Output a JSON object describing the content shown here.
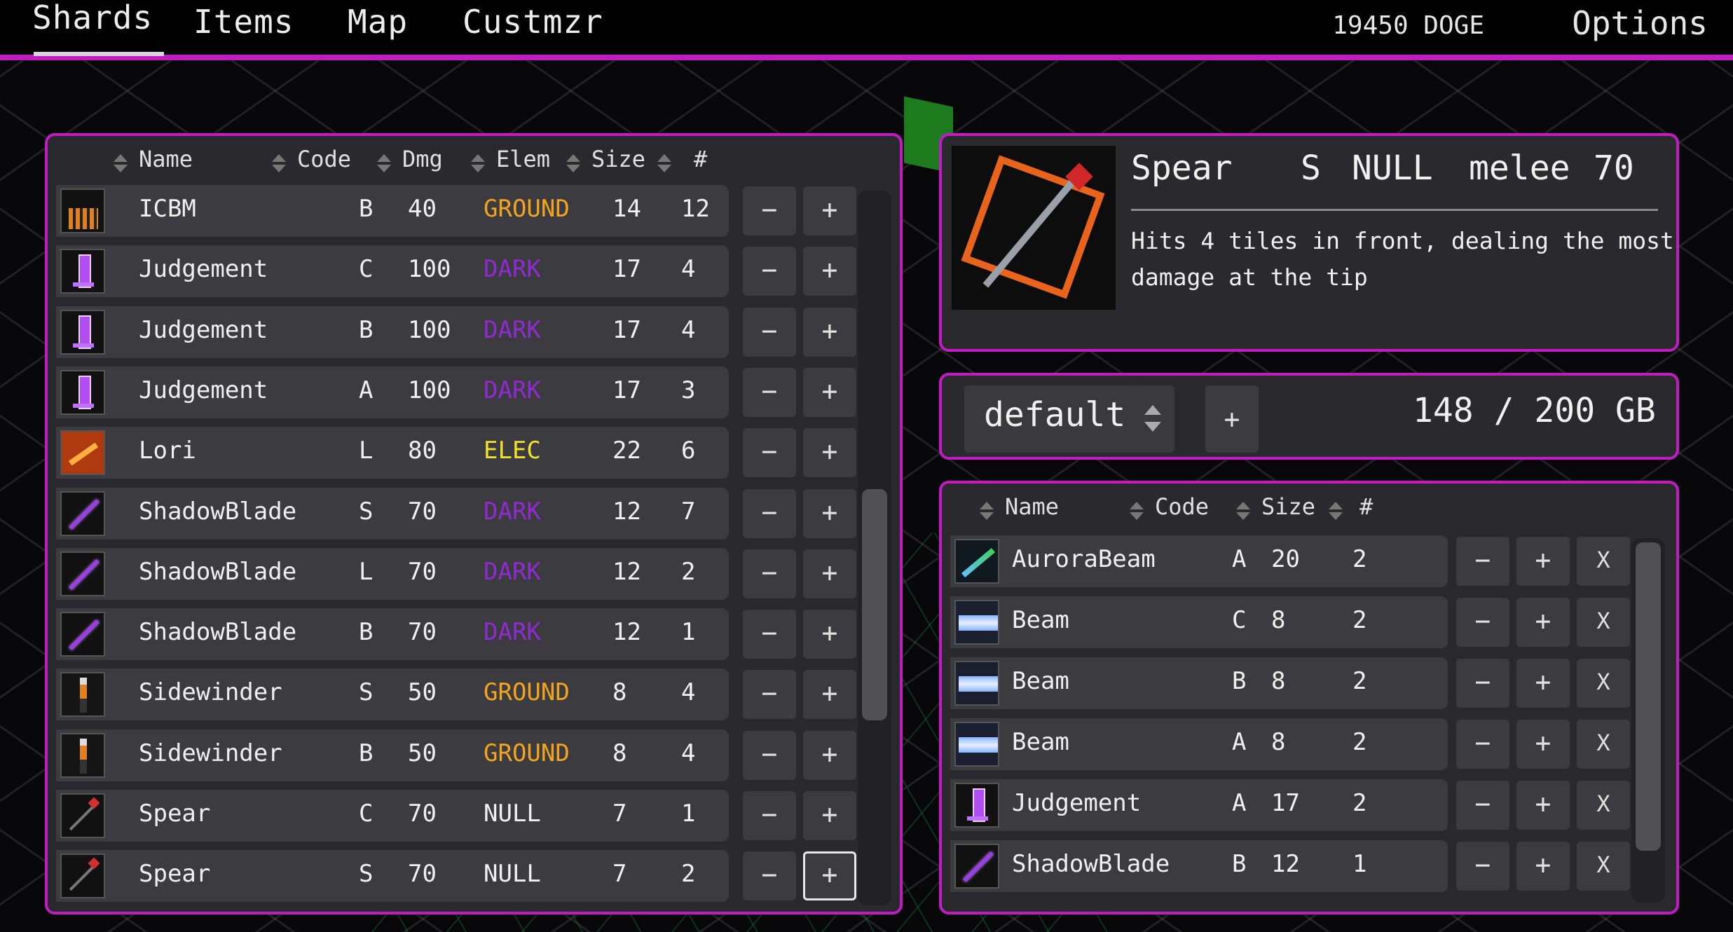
{
  "nav": {
    "tabs": [
      "Shards",
      "Items",
      "Map",
      "Custmzr"
    ],
    "currency": "19450 DOGE",
    "options": "Options"
  },
  "inventory": {
    "headers": [
      "Name",
      "Code",
      "Dmg",
      "Elem",
      "Size",
      "#"
    ],
    "rows": [
      {
        "icon": "icbm-icon",
        "name": "ICBM",
        "code": "B",
        "dmg": "40",
        "elem": "GROUND",
        "size": "14",
        "count": "12"
      },
      {
        "icon": "judgement-icon",
        "name": "Judgement",
        "code": "C",
        "dmg": "100",
        "elem": "DARK",
        "size": "17",
        "count": "4"
      },
      {
        "icon": "judgement-icon",
        "name": "Judgement",
        "code": "B",
        "dmg": "100",
        "elem": "DARK",
        "size": "17",
        "count": "4"
      },
      {
        "icon": "judgement-icon",
        "name": "Judgement",
        "code": "A",
        "dmg": "100",
        "elem": "DARK",
        "size": "17",
        "count": "3"
      },
      {
        "icon": "lori-icon",
        "name": "Lori",
        "code": "L",
        "dmg": "80",
        "elem": "ELEC",
        "size": "22",
        "count": "6"
      },
      {
        "icon": "shadowblade-icon",
        "name": "ShadowBlade",
        "code": "S",
        "dmg": "70",
        "elem": "DARK",
        "size": "12",
        "count": "7"
      },
      {
        "icon": "shadowblade-icon",
        "name": "ShadowBlade",
        "code": "L",
        "dmg": "70",
        "elem": "DARK",
        "size": "12",
        "count": "2"
      },
      {
        "icon": "shadowblade-icon",
        "name": "ShadowBlade",
        "code": "B",
        "dmg": "70",
        "elem": "DARK",
        "size": "12",
        "count": "1"
      },
      {
        "icon": "sidewinder-icon",
        "name": "Sidewinder",
        "code": "S",
        "dmg": "50",
        "elem": "GROUND",
        "size": "8",
        "count": "4"
      },
      {
        "icon": "sidewinder-icon",
        "name": "Sidewinder",
        "code": "B",
        "dmg": "50",
        "elem": "GROUND",
        "size": "8",
        "count": "4"
      },
      {
        "icon": "spear-icon",
        "name": "Spear",
        "code": "C",
        "dmg": "70",
        "elem": "NULL",
        "size": "7",
        "count": "1"
      },
      {
        "icon": "spear-icon",
        "name": "Spear",
        "code": "S",
        "dmg": "70",
        "elem": "NULL",
        "size": "7",
        "count": "2"
      }
    ],
    "minus": "−",
    "plus": "+",
    "scroll_position": 0.62
  },
  "detail": {
    "icon": "spear-large-icon",
    "name": "Spear",
    "code": "S",
    "elem": "NULL",
    "type": "melee",
    "dmg": "70",
    "description_line1": "Hits 4 tiles in front, dealing the most",
    "description_line2": "damage at the tip"
  },
  "folder": {
    "name": "default",
    "add": "+",
    "capacity": "148 / 200 GB"
  },
  "loadout": {
    "headers": [
      "Name",
      "Code",
      "Size",
      "#"
    ],
    "rows": [
      {
        "icon": "aurorabeam-icon",
        "name": "AuroraBeam",
        "code": "A",
        "size": "20",
        "count": "2"
      },
      {
        "icon": "beam-icon",
        "name": "Beam",
        "code": "C",
        "size": "8",
        "count": "2"
      },
      {
        "icon": "beam-icon",
        "name": "Beam",
        "code": "B",
        "size": "8",
        "count": "2"
      },
      {
        "icon": "beam-icon",
        "name": "Beam",
        "code": "A",
        "size": "8",
        "count": "2"
      },
      {
        "icon": "judgement-icon",
        "name": "Judgement",
        "code": "A",
        "size": "17",
        "count": "2"
      },
      {
        "icon": "shadowblade-icon",
        "name": "ShadowBlade",
        "code": "B",
        "size": "12",
        "count": "1"
      }
    ],
    "minus": "−",
    "plus": "+",
    "remove": "X",
    "scroll_position": 0.0
  },
  "colors": {
    "accent": "#c21bc4",
    "GROUND": "#f2a420",
    "DARK": "#8f2bd1",
    "ELEC": "#f2e02b",
    "NULL": "#f0f0f0"
  }
}
